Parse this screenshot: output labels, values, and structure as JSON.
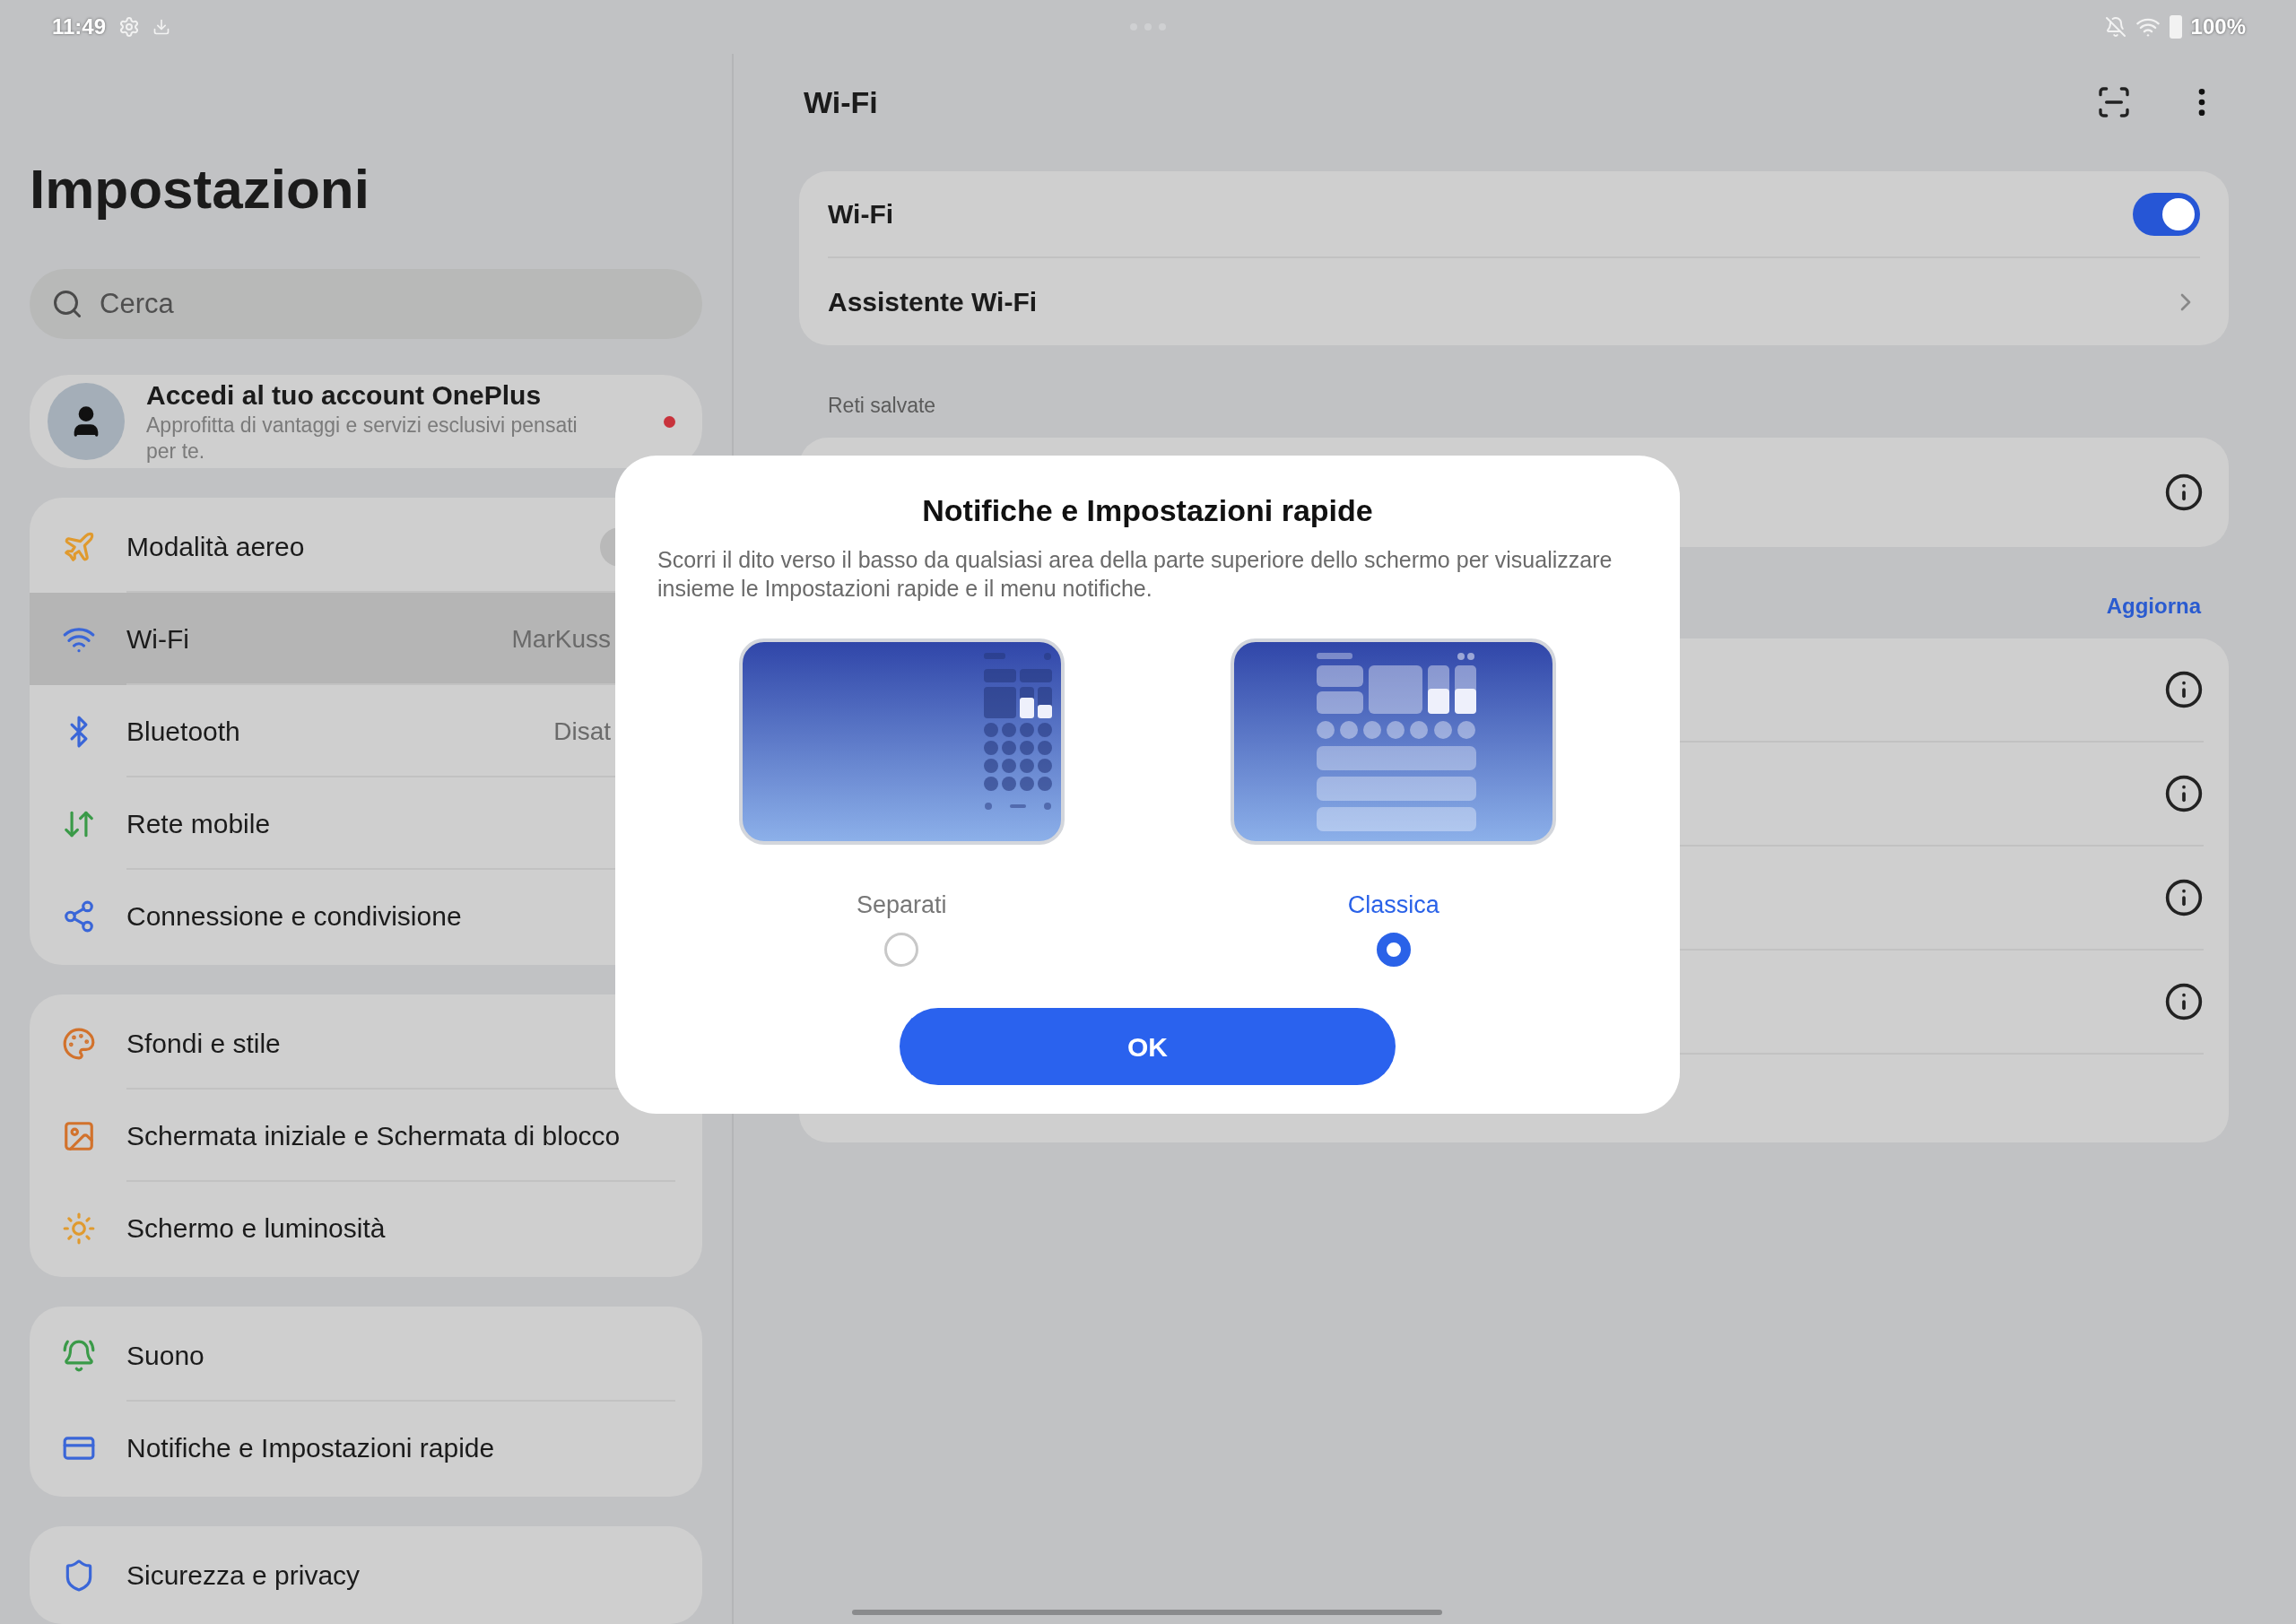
{
  "status_bar": {
    "time": "11:49",
    "battery": "100%"
  },
  "sidebar": {
    "title": "Impostazioni",
    "search": {
      "placeholder": "Cerca"
    },
    "account": {
      "title": "Accedi al tuo account OnePlus",
      "subtitle": "Approfitta di vantaggi e servizi esclusivi pensati per te.",
      "notification_dot": true
    },
    "groups": [
      {
        "items": [
          {
            "label": "Modalità aereo",
            "selected": false
          },
          {
            "label": "Wi-Fi",
            "value": "MarKuss",
            "selected": true
          },
          {
            "label": "Bluetooth",
            "value": "Disat",
            "selected": false
          },
          {
            "label": "Rete mobile",
            "selected": false
          },
          {
            "label": "Connessione e condivisione",
            "selected": false
          }
        ]
      },
      {
        "items": [
          {
            "label": "Sfondi e stile",
            "selected": false
          },
          {
            "label": "Schermata iniziale e Schermata di blocco",
            "selected": false
          },
          {
            "label": "Schermo e luminosità",
            "selected": false
          }
        ]
      },
      {
        "items": [
          {
            "label": "Suono",
            "selected": false
          },
          {
            "label": "Notifiche e Impostazioni rapide",
            "selected": false
          }
        ]
      },
      {
        "items": [
          {
            "label": "Sicurezza e privacy",
            "selected": false
          }
        ]
      }
    ]
  },
  "wifi_page": {
    "title": "Wi-Fi",
    "wifi_toggle": {
      "label": "Wi-Fi",
      "on": true
    },
    "assistant": {
      "label": "Assistente Wi-Fi"
    },
    "saved_networks_label": "Reti salvate",
    "refresh_link": "Aggiorna"
  },
  "dialog": {
    "title": "Notifiche e Impostazioni rapide",
    "body": "Scorri il dito verso il basso da qualsiasi area della parte superiore dello schermo per visualizzare insieme le Impostazioni rapide e il menu notifiche.",
    "options": [
      {
        "kind": "separate",
        "label": "Separati",
        "selected": false
      },
      {
        "kind": "classic",
        "label": "Classica",
        "selected": true
      }
    ],
    "confirm_button": "OK"
  }
}
